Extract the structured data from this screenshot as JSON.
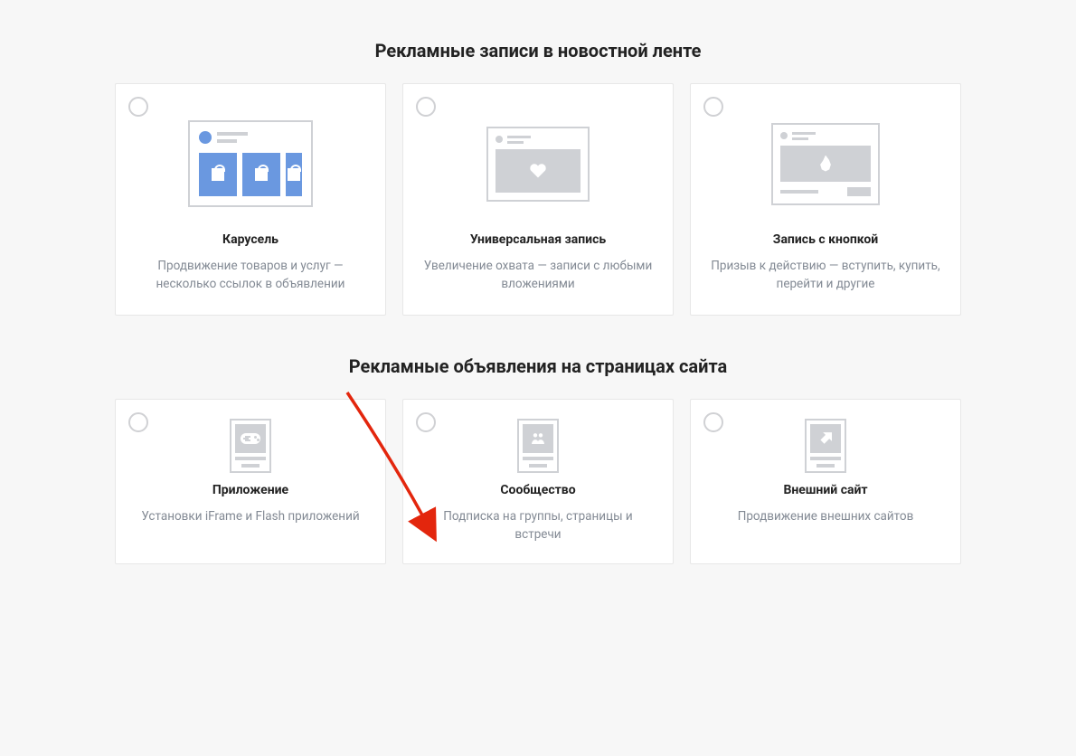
{
  "sections": [
    {
      "title": "Рекламные записи в новостной ленте",
      "cards": [
        {
          "title": "Карусель",
          "desc": "Продвижение товаров и услуг — несколько ссылок в объявлении"
        },
        {
          "title": "Универсальная запись",
          "desc": "Увеличение охвата — записи с любыми вложениями"
        },
        {
          "title": "Запись с кнопкой",
          "desc": "Призыв к действию — вступить, купить, перейти и другие"
        }
      ]
    },
    {
      "title": "Рекламные объявления на страницах сайта",
      "cards": [
        {
          "title": "Приложение",
          "desc": "Установки iFrame и Flash приложений"
        },
        {
          "title": "Сообщество",
          "desc": "Подписка на группы, страницы и встречи"
        },
        {
          "title": "Внешний сайт",
          "desc": "Продвижение внешних сайтов"
        }
      ]
    }
  ],
  "colors": {
    "accent": "#6a98e0",
    "arrow": "#e3260d"
  }
}
